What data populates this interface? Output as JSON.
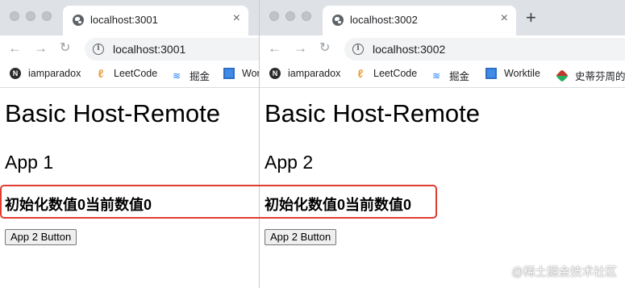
{
  "windows": [
    {
      "tab_title": "localhost:3001",
      "url": "localhost:3001",
      "bookmarks": [
        {
          "label": "iamparadox",
          "icon": "notion-icon"
        },
        {
          "label": "LeetCode",
          "icon": "leetcode-icon"
        },
        {
          "label": "掘金",
          "icon": "juejin-icon"
        },
        {
          "label": "Wor",
          "icon": "worktile-icon"
        }
      ],
      "heading": "Basic Host-Remote",
      "app_title": "App 1",
      "counter_text": "初始化数值0当前数值0",
      "button_label": "App 2 Button"
    },
    {
      "tab_title": "localhost:3002",
      "url": "localhost:3002",
      "bookmarks": [
        {
          "label": "iamparadox",
          "icon": "notion-icon"
        },
        {
          "label": "LeetCode",
          "icon": "leetcode-icon"
        },
        {
          "label": "掘金",
          "icon": "juejin-icon"
        },
        {
          "label": "Worktile",
          "icon": "worktile-icon"
        },
        {
          "label": "史蒂芬周的",
          "icon": "bookmark-icon"
        }
      ],
      "heading": "Basic Host-Remote",
      "app_title": "App 2",
      "counter_text": "初始化数值0当前数值0",
      "button_label": "App 2 Button"
    }
  ],
  "icons": {
    "close": "×",
    "new_tab": "+",
    "back": "←",
    "forward": "→",
    "reload": "↻",
    "info": "i"
  },
  "watermark": "@稀土掘金技术社区",
  "highlight_color": "#e03c31"
}
